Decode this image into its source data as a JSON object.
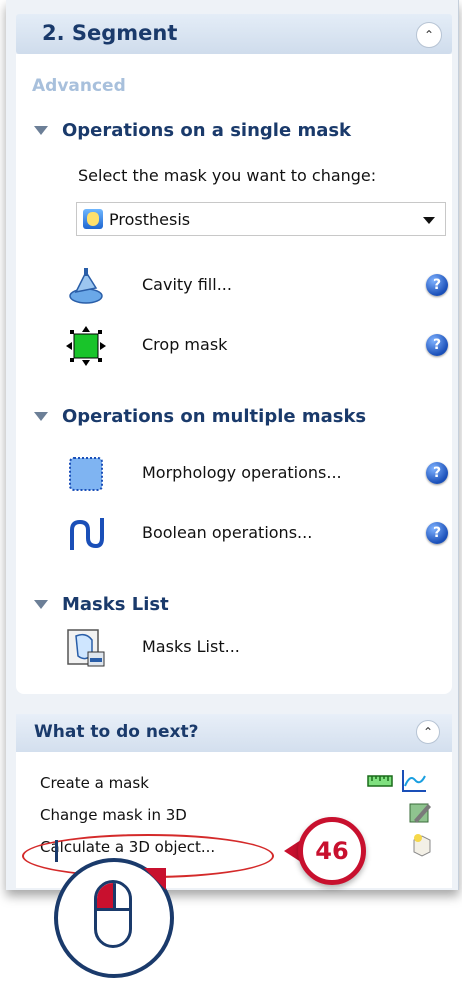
{
  "segment": {
    "title": "2. Segment",
    "advanced_label": "Advanced"
  },
  "single_mask": {
    "header": "Operations on a single mask",
    "prompt": "Select the mask you want to change:",
    "selected_mask": "Prosthesis",
    "ops": [
      {
        "label": "Cavity fill...",
        "icon": "cavity-fill-icon"
      },
      {
        "label": "Crop mask",
        "icon": "crop-mask-icon"
      }
    ]
  },
  "multiple_masks": {
    "header": "Operations on multiple masks",
    "ops": [
      {
        "label": "Morphology operations...",
        "icon": "morphology-icon"
      },
      {
        "label": "Boolean operations...",
        "icon": "boolean-icon"
      }
    ]
  },
  "masks_list": {
    "header": "Masks List",
    "item_label": "Masks List..."
  },
  "next": {
    "title": "What to do next?",
    "items": [
      {
        "label": "Create a mask"
      },
      {
        "label": "Change mask in 3D"
      },
      {
        "label": "Calculate a 3D object..."
      }
    ]
  },
  "callout": {
    "number": "46"
  },
  "colors": {
    "accent_red": "#c8102e",
    "header_blue": "#1a3a6b",
    "help_blue": "#1a4fb8"
  }
}
